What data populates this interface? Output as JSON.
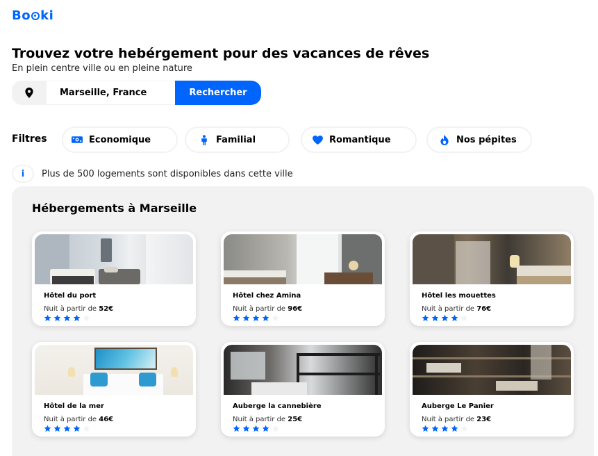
{
  "brand": {
    "prefix": "Bo",
    "suffix": "ki",
    "color": "#0065fc"
  },
  "hero": {
    "title": "Trouvez votre hebérgement pour des vacances de rêves",
    "subtitle": "En plein centre ville ou en pleine nature"
  },
  "search": {
    "icon": "location-pin-icon",
    "value": "Marseille, France",
    "button_label": "Rechercher"
  },
  "filters": {
    "label": "Filtres",
    "items": [
      {
        "label": "Economique",
        "icon": "money-icon"
      },
      {
        "label": "Familial",
        "icon": "person-icon"
      },
      {
        "label": "Romantique",
        "icon": "heart-icon"
      },
      {
        "label": "Nos pépites",
        "icon": "gem-icon"
      }
    ]
  },
  "info": {
    "icon": "info-icon",
    "text": "Plus de 500 logements sont disponibles dans cette ville"
  },
  "listings": {
    "title": "Hébergements à Marseille",
    "price_prefix": "Nuit à partir de ",
    "max_rating": 5,
    "cards": [
      {
        "name": "Hôtel du port",
        "price": "52€",
        "rating": 4
      },
      {
        "name": "Hôtel chez Amina",
        "price": "96€",
        "rating": 4
      },
      {
        "name": "Hôtel les mouettes",
        "price": "76€",
        "rating": 4
      },
      {
        "name": "Hôtel de la mer",
        "price": "46€",
        "rating": 4
      },
      {
        "name": "Auberge la cannebière",
        "price": "25€",
        "rating": 4
      },
      {
        "name": "Auberge Le Panier",
        "price": "23€",
        "rating": 4
      }
    ]
  },
  "colors": {
    "accent": "#0065fc",
    "panel_background": "#f2f2f2",
    "star_empty": "#f2f2f2"
  }
}
